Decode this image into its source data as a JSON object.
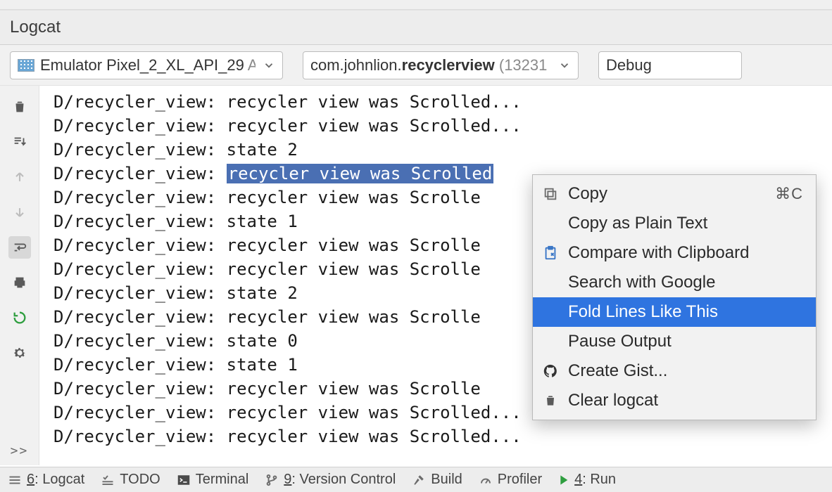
{
  "title": "Logcat",
  "toolbar": {
    "device": {
      "name": "Emulator Pixel_2_XL_API_29",
      "os_tail": " Anc"
    },
    "app": {
      "pkg_prefix": "com.johnlion.",
      "pkg_bold": "recyclerview",
      "pid_tail": " (13231"
    },
    "level": "Debug"
  },
  "log_lines": [
    {
      "tag": "D/recycler_view:",
      "msg": "recycler view was Scrolled...",
      "sel": false
    },
    {
      "tag": "D/recycler_view:",
      "msg": "recycler view was Scrolled...",
      "sel": false
    },
    {
      "tag": "D/recycler_view:",
      "msg": "state 2",
      "sel": false
    },
    {
      "tag": "D/recycler_view:",
      "msg": "recycler view was Scrolled",
      "sel": true
    },
    {
      "tag": "D/recycler_view:",
      "msg": "recycler view was Scrolle",
      "sel": false
    },
    {
      "tag": "D/recycler_view:",
      "msg": "state 1",
      "sel": false
    },
    {
      "tag": "D/recycler_view:",
      "msg": "recycler view was Scrolle",
      "sel": false
    },
    {
      "tag": "D/recycler_view:",
      "msg": "recycler view was Scrolle",
      "sel": false
    },
    {
      "tag": "D/recycler_view:",
      "msg": "state 2",
      "sel": false
    },
    {
      "tag": "D/recycler_view:",
      "msg": "recycler view was Scrolle",
      "sel": false
    },
    {
      "tag": "D/recycler_view:",
      "msg": "state 0",
      "sel": false
    },
    {
      "tag": "D/recycler_view:",
      "msg": "state 1",
      "sel": false
    },
    {
      "tag": "D/recycler_view:",
      "msg": "recycler view was Scrolle",
      "sel": false
    },
    {
      "tag": "D/recycler_view:",
      "msg": "recycler view was Scrolled...",
      "sel": false
    },
    {
      "tag": "D/recycler_view:",
      "msg": "recycler view was Scrolled...",
      "sel": false
    }
  ],
  "rail_icons": [
    {
      "name": "trash-icon"
    },
    {
      "name": "scroll-to-end-icon"
    },
    {
      "name": "arrow-up-icon"
    },
    {
      "name": "arrow-down-icon"
    },
    {
      "name": "soft-wrap-icon"
    },
    {
      "name": "print-icon"
    },
    {
      "name": "restart-icon"
    },
    {
      "name": "gear-icon"
    }
  ],
  "context_menu": [
    {
      "icon": "copy-icon",
      "label": "Copy",
      "shortcut": "⌘C",
      "selected": false
    },
    {
      "icon": "",
      "label": "Copy as Plain Text",
      "shortcut": "",
      "selected": false
    },
    {
      "icon": "compare-clipboard-icon",
      "label": "Compare with Clipboard",
      "shortcut": "",
      "selected": false
    },
    {
      "icon": "",
      "label": "Search with Google",
      "shortcut": "",
      "selected": false
    },
    {
      "icon": "",
      "label": "Fold Lines Like This",
      "shortcut": "",
      "selected": true
    },
    {
      "icon": "",
      "label": "Pause Output",
      "shortcut": "",
      "selected": false
    },
    {
      "icon": "github-icon",
      "label": "Create Gist...",
      "shortcut": "",
      "selected": false
    },
    {
      "icon": "trash-icon",
      "label": "Clear logcat",
      "shortcut": "",
      "selected": false
    }
  ],
  "status": {
    "logcat": {
      "prefix": "6",
      "label": ": Logcat"
    },
    "todo": {
      "label": "TODO"
    },
    "terminal": {
      "label": "Terminal"
    },
    "vcs": {
      "prefix": "9",
      "label": ": Version Control"
    },
    "build": {
      "label": "Build"
    },
    "profiler": {
      "label": "Profiler"
    },
    "run": {
      "prefix": "4",
      "label": ": Run"
    }
  }
}
